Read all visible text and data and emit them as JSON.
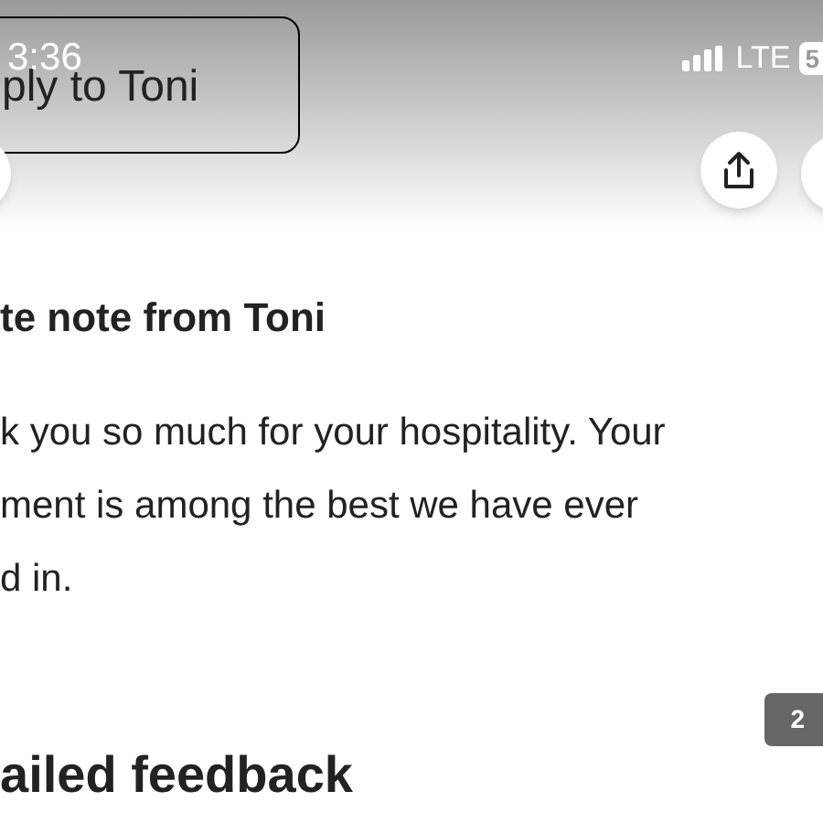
{
  "status_bar": {
    "time": "3:36",
    "network": "LTE",
    "battery": "5"
  },
  "reply_button": {
    "label": "ply to Toni"
  },
  "note": {
    "title": "te note from Toni",
    "lines": [
      "k you so much for your hospitality. Your",
      "ment is among the best we have ever",
      "d in."
    ]
  },
  "page_badge": "2",
  "next_heading": "ailed feedback"
}
